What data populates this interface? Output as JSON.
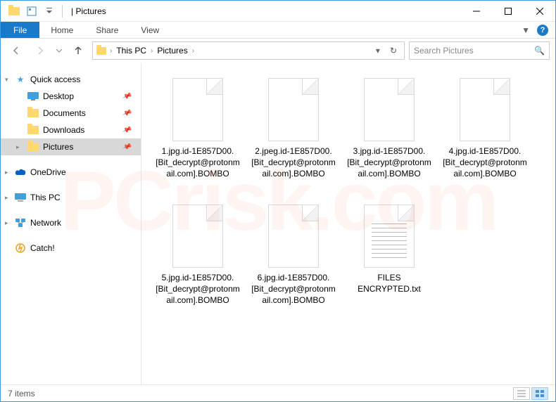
{
  "window": {
    "title": "Pictures",
    "title_sep": " | "
  },
  "ribbon": {
    "file": "File",
    "tabs": [
      "Home",
      "Share",
      "View"
    ]
  },
  "breadcrumb": {
    "items": [
      "This PC",
      "Pictures"
    ]
  },
  "search": {
    "placeholder": "Search Pictures"
  },
  "sidebar": {
    "quick_access": "Quick access",
    "pinned": [
      {
        "label": "Desktop"
      },
      {
        "label": "Documents"
      },
      {
        "label": "Downloads"
      },
      {
        "label": "Pictures",
        "selected": true
      }
    ],
    "onedrive": "OneDrive",
    "this_pc": "This PC",
    "network": "Network",
    "catch": "Catch!"
  },
  "files": [
    {
      "name": "1.jpg.id-1E857D00.[Bit_decrypt@protonmail.com].BOMBO",
      "type": "blank"
    },
    {
      "name": "2.jpeg.id-1E857D00.[Bit_decrypt@protonmail.com].BOMBO",
      "type": "blank"
    },
    {
      "name": "3.jpg.id-1E857D00.[Bit_decrypt@protonmail.com].BOMBO",
      "type": "blank"
    },
    {
      "name": "4.jpg.id-1E857D00.[Bit_decrypt@protonmail.com].BOMBO",
      "type": "blank"
    },
    {
      "name": "5.jpg.id-1E857D00.[Bit_decrypt@protonmail.com].BOMBO",
      "type": "blank"
    },
    {
      "name": "6.jpg.id-1E857D00.[Bit_decrypt@protonmail.com].BOMBO",
      "type": "blank"
    },
    {
      "name": "FILES ENCRYPTED.txt",
      "type": "text"
    }
  ],
  "status": {
    "count": "7 items"
  }
}
